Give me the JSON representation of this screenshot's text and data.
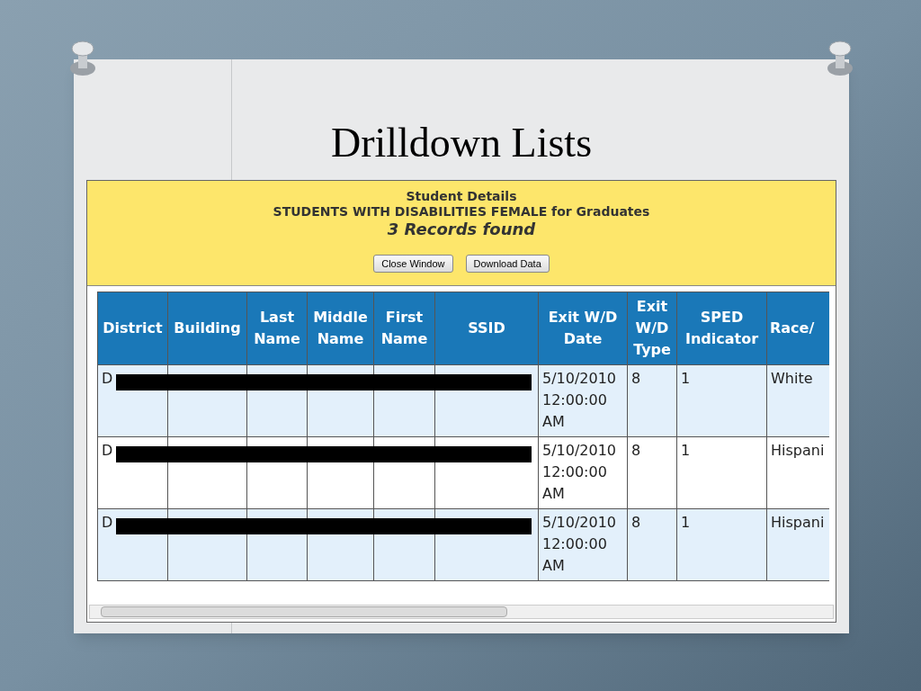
{
  "slide": {
    "title": "Drilldown Lists"
  },
  "popup": {
    "heading": "Student Details",
    "subheading": "STUDENTS WITH DISABILITIES FEMALE for Graduates",
    "count": "3 Records found",
    "buttons": [
      "Close Window",
      "Download Data"
    ]
  },
  "table": {
    "columns": [
      "District",
      "Building",
      "Last Name",
      "Middle Name",
      "First Name",
      "SSID",
      "Exit W/D Date",
      "Exit W/D Type",
      "SPED Indicator",
      "Race/"
    ],
    "rows": [
      {
        "cells": [
          "D",
          "",
          "",
          "",
          "",
          "",
          "5/10/2010 12:00:00 AM",
          "8",
          "1",
          "White"
        ],
        "redacted": true
      },
      {
        "cells": [
          "D",
          "",
          "",
          "",
          "",
          "",
          "5/10/2010 12:00:00 AM",
          "8",
          "1",
          "Hispani"
        ],
        "redacted": true
      },
      {
        "cells": [
          "D",
          "",
          "",
          "",
          "",
          "",
          "5/10/2010 12:00:00 AM",
          "8",
          "1",
          "Hispani"
        ],
        "redacted": true
      }
    ]
  }
}
